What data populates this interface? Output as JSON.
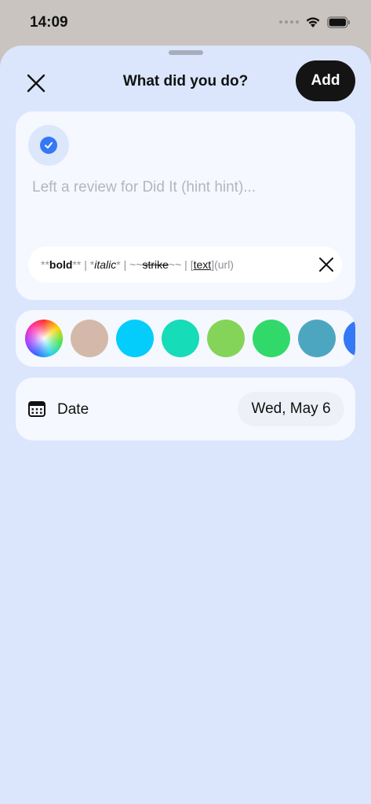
{
  "status_bar": {
    "time": "14:09"
  },
  "header": {
    "title": "What did you do?",
    "add_label": "Add"
  },
  "entry": {
    "placeholder": "Left a review for Did It (hint hint)..."
  },
  "format_hint": {
    "bold_prefix": "**",
    "bold_word": "bold",
    "bold_suffix": "**",
    "sep1": " | ",
    "italic_prefix": "*",
    "italic_word": "italic",
    "italic_suffix": "*",
    "sep2": " | ",
    "strike_prefix": "~~",
    "strike_word": "strike",
    "strike_suffix": "~~",
    "sep3": " | ",
    "link_open": "[",
    "link_word": "text",
    "link_close": "]",
    "link_url": "(url)"
  },
  "colors": {
    "swatches": [
      "rainbow",
      "#d4b9aa",
      "#04cdfc",
      "#16dcb8",
      "#84d45a",
      "#31d96a",
      "#4da6c0",
      "#3478f6"
    ],
    "check_color": "#3478f6"
  },
  "date_row": {
    "label": "Date",
    "value": "Wed, May 6"
  },
  "icons": {
    "close": "close-icon",
    "check": "checkmark-icon",
    "format_close": "close-icon",
    "calendar": "calendar-icon",
    "wifi": "wifi-icon",
    "battery": "battery-icon"
  }
}
